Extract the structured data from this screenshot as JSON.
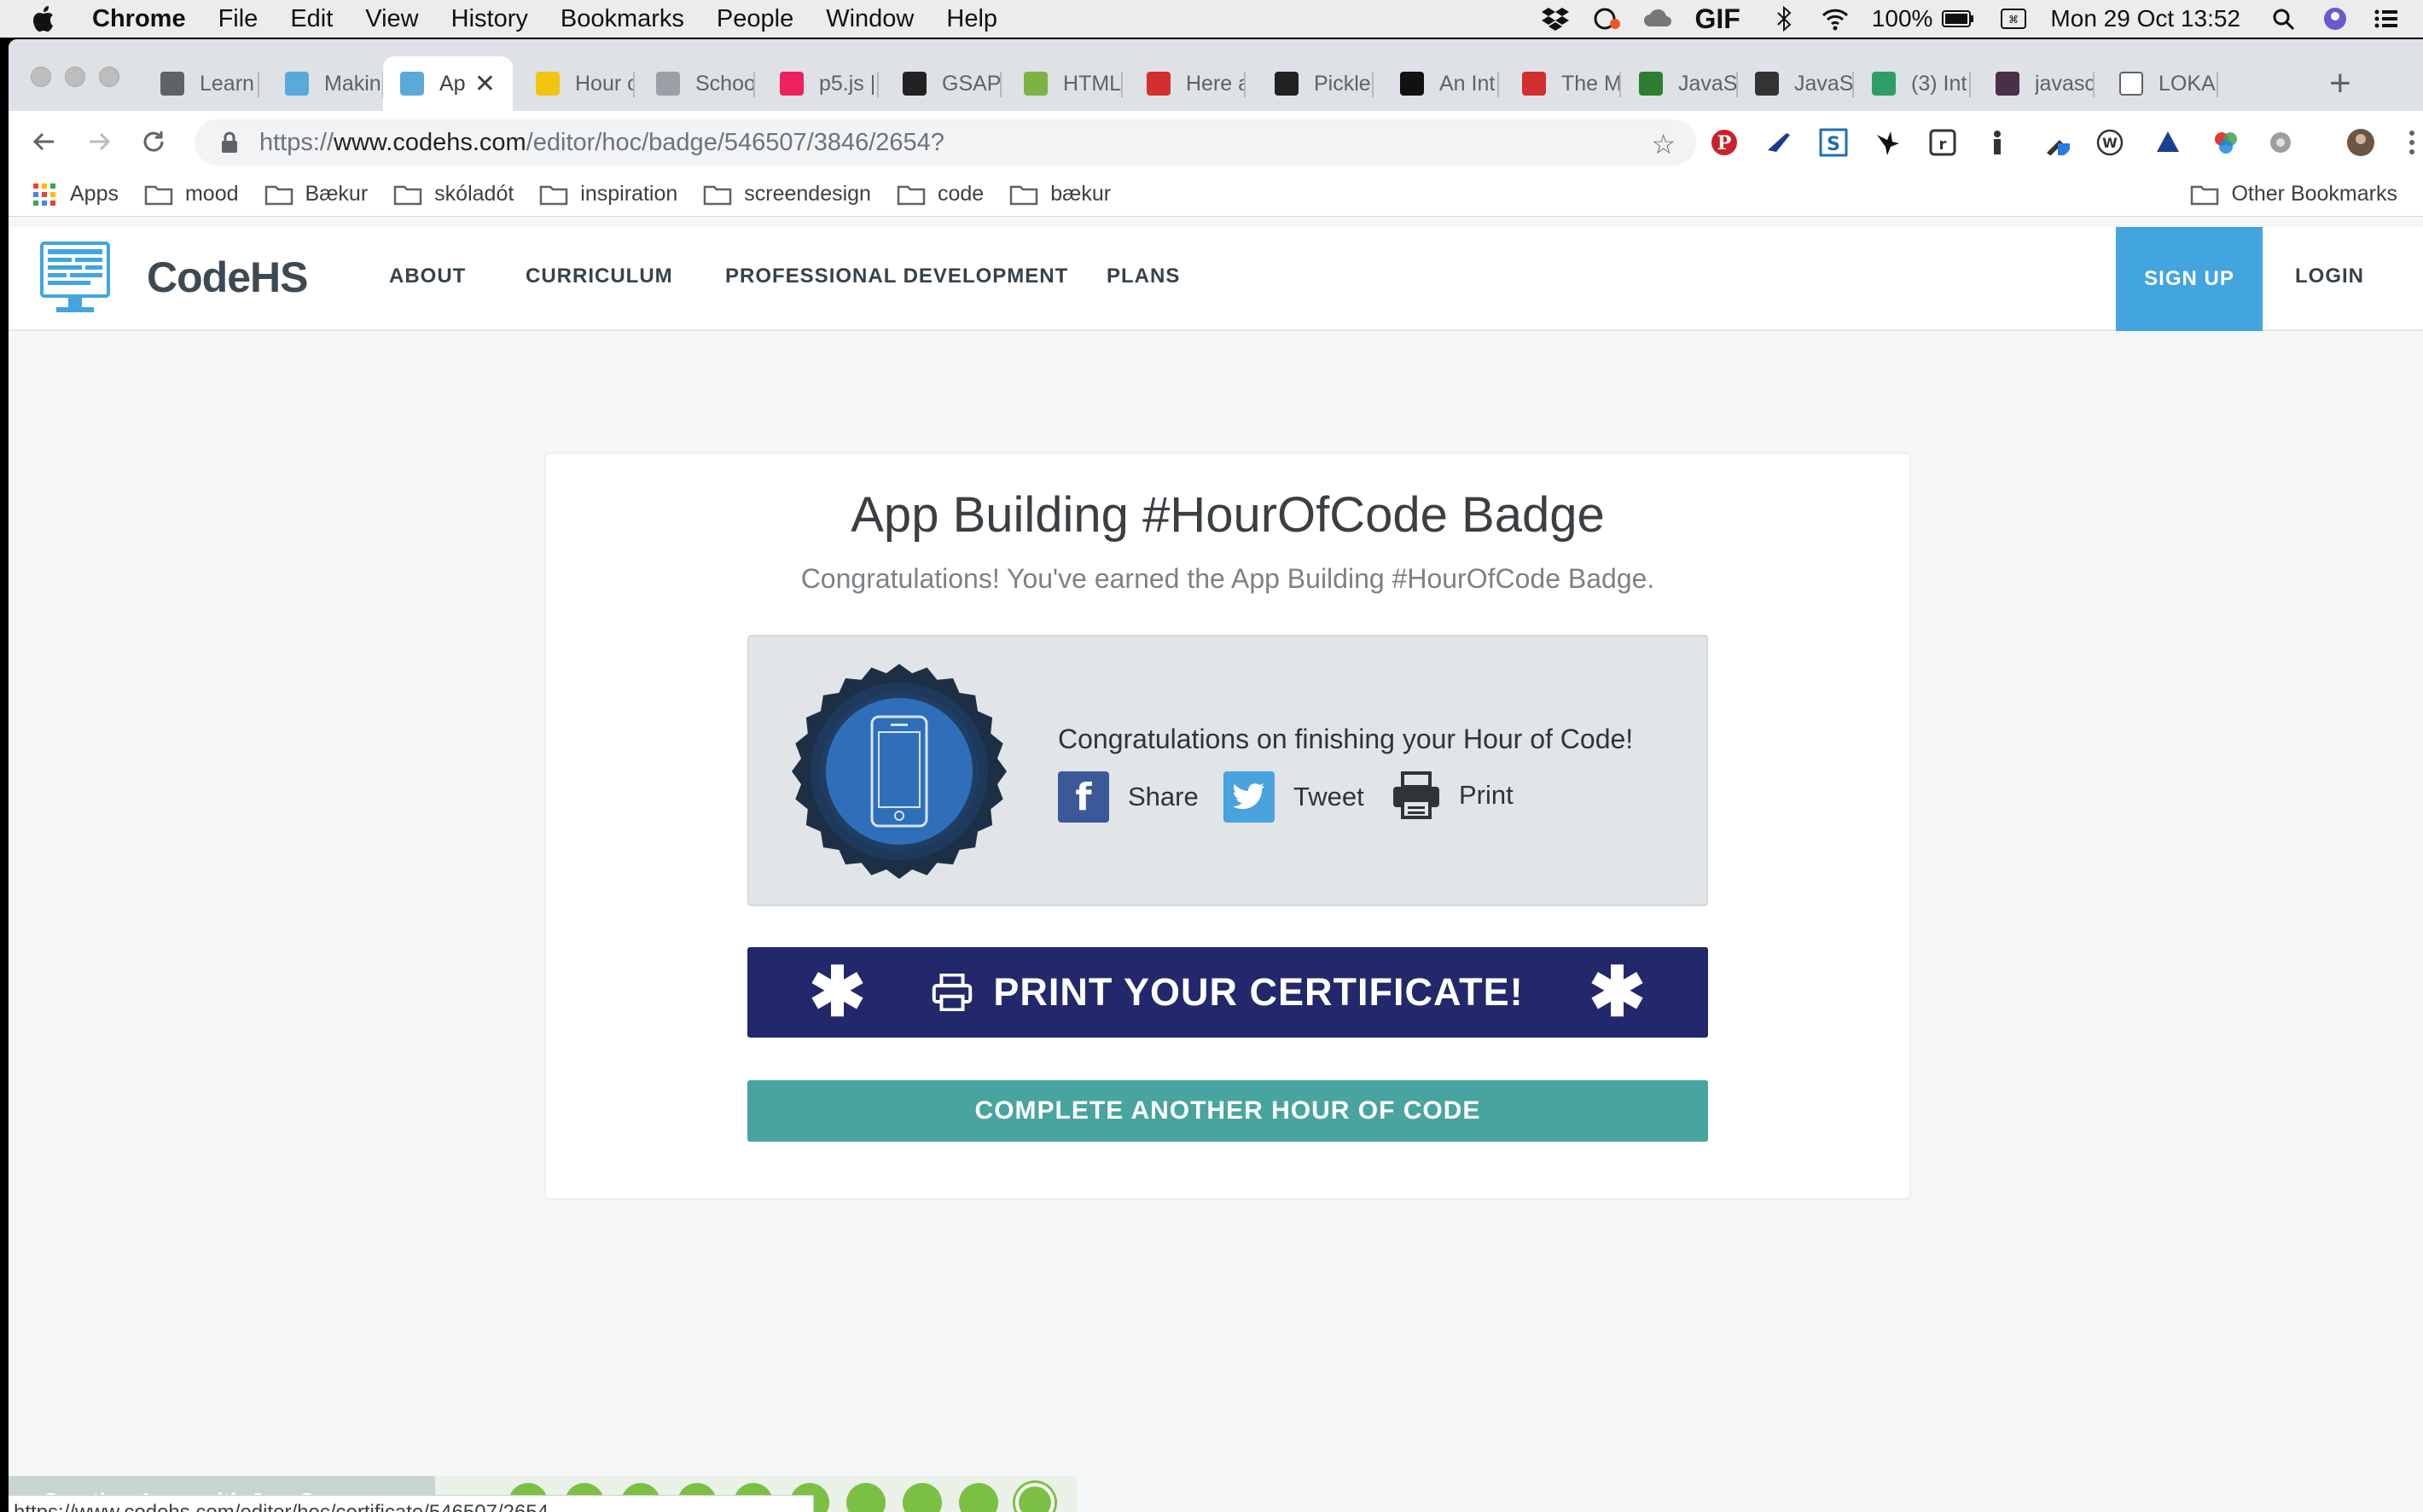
{
  "menubar": {
    "app": "Chrome",
    "menus": [
      "File",
      "Edit",
      "View",
      "History",
      "Bookmarks",
      "People",
      "Window",
      "Help"
    ],
    "battery": "100%",
    "datetime": "Mon 29 Oct  13:52"
  },
  "tabs": [
    {
      "label": "Learn",
      "fav": "#5f6368"
    },
    {
      "label": "Makin",
      "fav": "#59a9d9"
    },
    {
      "label": "Ap",
      "fav": "#59a9d9",
      "active": true
    },
    {
      "label": "Hour c",
      "fav": "#f1c40f"
    },
    {
      "label": "Schoo",
      "fav": "#9aa0a6"
    },
    {
      "label": "p5.js |",
      "fav": "#ed225d"
    },
    {
      "label": "GSAP",
      "fav": "#222222"
    },
    {
      "label": "HTML",
      "fav": "#7cb342"
    },
    {
      "label": "Here a",
      "fav": "#d32f2f"
    },
    {
      "label": "Pickle",
      "fav": "#222222"
    },
    {
      "label": "An Int",
      "fav": "#111111"
    },
    {
      "label": "The M",
      "fav": "#d32f2f"
    },
    {
      "label": "JavaS",
      "fav": "#2e7d32"
    },
    {
      "label": "JavaS",
      "fav": "#333333"
    },
    {
      "label": "(3) Int",
      "fav": "#2e9d6a"
    },
    {
      "label": "javasc",
      "fav": "#4a2f48"
    },
    {
      "label": "LOKA ",
      "fav": "#ffffff"
    }
  ],
  "toolbar": {
    "url_scheme": "https://",
    "url_host": "www.codehs.com",
    "url_path": "/editor/hoc/badge/546507/3846/2654?"
  },
  "bookmarks": {
    "apps": "Apps",
    "folders": [
      "mood",
      "Bækur",
      "skóladót",
      "inspiration",
      "screendesign",
      "code",
      "bækur"
    ],
    "other": "Other Bookmarks"
  },
  "site": {
    "logo": "CodeHS",
    "nav": [
      "ABOUT",
      "CURRICULUM",
      "PROFESSIONAL DEVELOPMENT",
      "PLANS"
    ],
    "signup": "SIGN UP",
    "login": "LOGIN"
  },
  "badge": {
    "title": "App Building #HourOfCode Badge",
    "subtitle": "Congratulations! You've earned the App Building #HourOfCode Badge.",
    "message": "Congratulations on finishing your Hour of Code!",
    "share": "Share",
    "tweet": "Tweet",
    "print": "Print",
    "print_certificate": "PRINT YOUR CERTIFICATE!",
    "another": "COMPLETE ANOTHER HOUR OF CODE"
  },
  "bottom": {
    "course": "Creating Apps with JavaScr...",
    "status_url": "https://www.codehs.com/editor/hoc/certificate/546507/2654"
  },
  "colors": {
    "codehs_blue": "#42a5e0",
    "certificate_navy": "#22286b",
    "teal": "#48a49e",
    "facebook": "#3b5998",
    "twitter": "#4aa3df"
  }
}
